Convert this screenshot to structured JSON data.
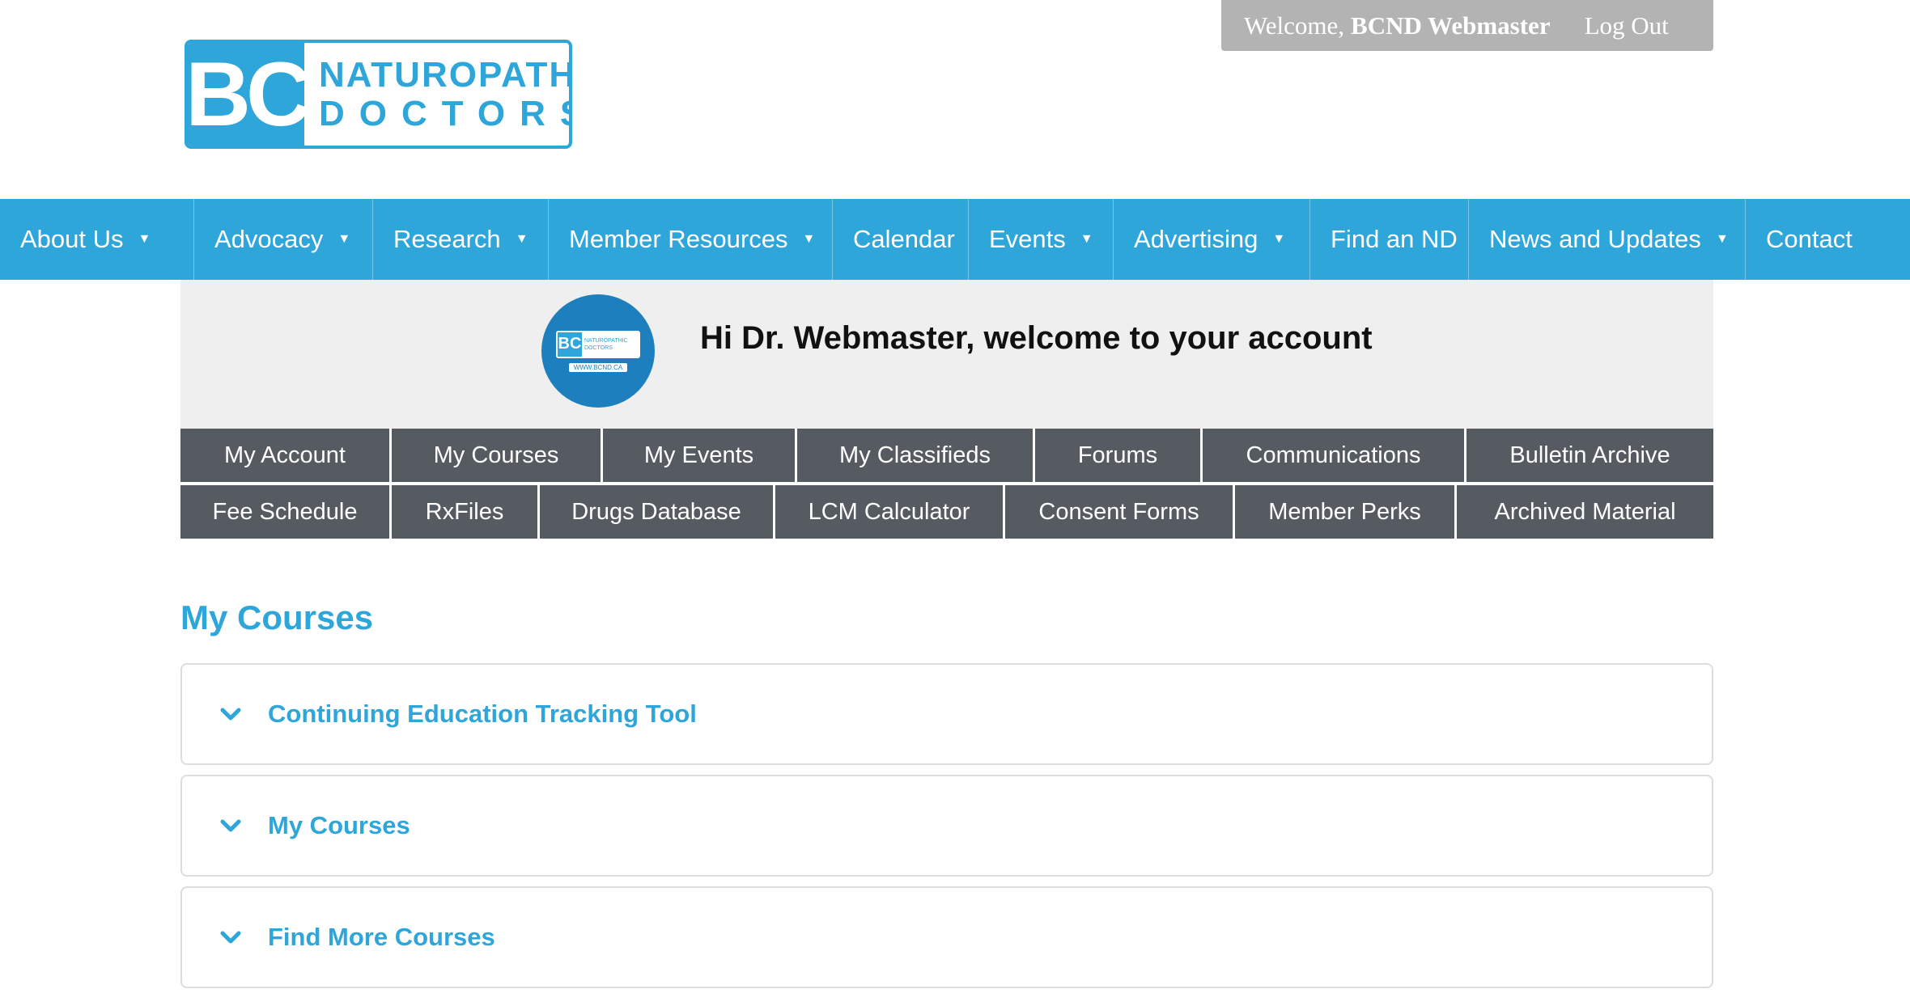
{
  "top_bar": {
    "welcome_prefix": "Welcome,",
    "welcome_name": "BCND Webmaster",
    "logout_label": "Log Out"
  },
  "logo": {
    "initials": "BC",
    "line1": "NATUROPATHIC",
    "line2": "DOCTORS",
    "mini_line1": "NATUROPATHIC",
    "mini_line2": "DOCTORS",
    "mini_url": "WWW.BCND.CA"
  },
  "main_nav": {
    "items": [
      {
        "label": "About Us",
        "has_dropdown": true
      },
      {
        "label": "Advocacy",
        "has_dropdown": true
      },
      {
        "label": "Research",
        "has_dropdown": true
      },
      {
        "label": "Member Resources",
        "has_dropdown": true
      },
      {
        "label": "Calendar",
        "has_dropdown": false
      },
      {
        "label": "Events",
        "has_dropdown": true
      },
      {
        "label": "Advertising",
        "has_dropdown": true
      },
      {
        "label": "Find an ND",
        "has_dropdown": false
      },
      {
        "label": "News and Updates",
        "has_dropdown": true
      },
      {
        "label": "Contact",
        "has_dropdown": false
      }
    ],
    "caret_icon": "▼"
  },
  "account": {
    "greeting": "Hi Dr. Webmaster, welcome to your account"
  },
  "tabs": {
    "row1": [
      "My Account",
      "My Courses",
      "My Events",
      "My Classifieds",
      "Forums",
      "Communications",
      "Bulletin Archive"
    ],
    "row2": [
      "Fee Schedule",
      "RxFiles",
      "Drugs Database",
      "LCM Calculator",
      "Consent Forms",
      "Member Perks",
      "Archived Material"
    ]
  },
  "section": {
    "title": "My Courses",
    "accordions": [
      {
        "label": "Continuing Education Tracking Tool"
      },
      {
        "label": "My Courses"
      },
      {
        "label": "Find More Courses"
      }
    ]
  },
  "colors": {
    "brand_blue": "#2ea6da",
    "tab_gray": "#565b62",
    "header_gray": "#efefef",
    "welcome_bar": "#b3b3b3"
  }
}
